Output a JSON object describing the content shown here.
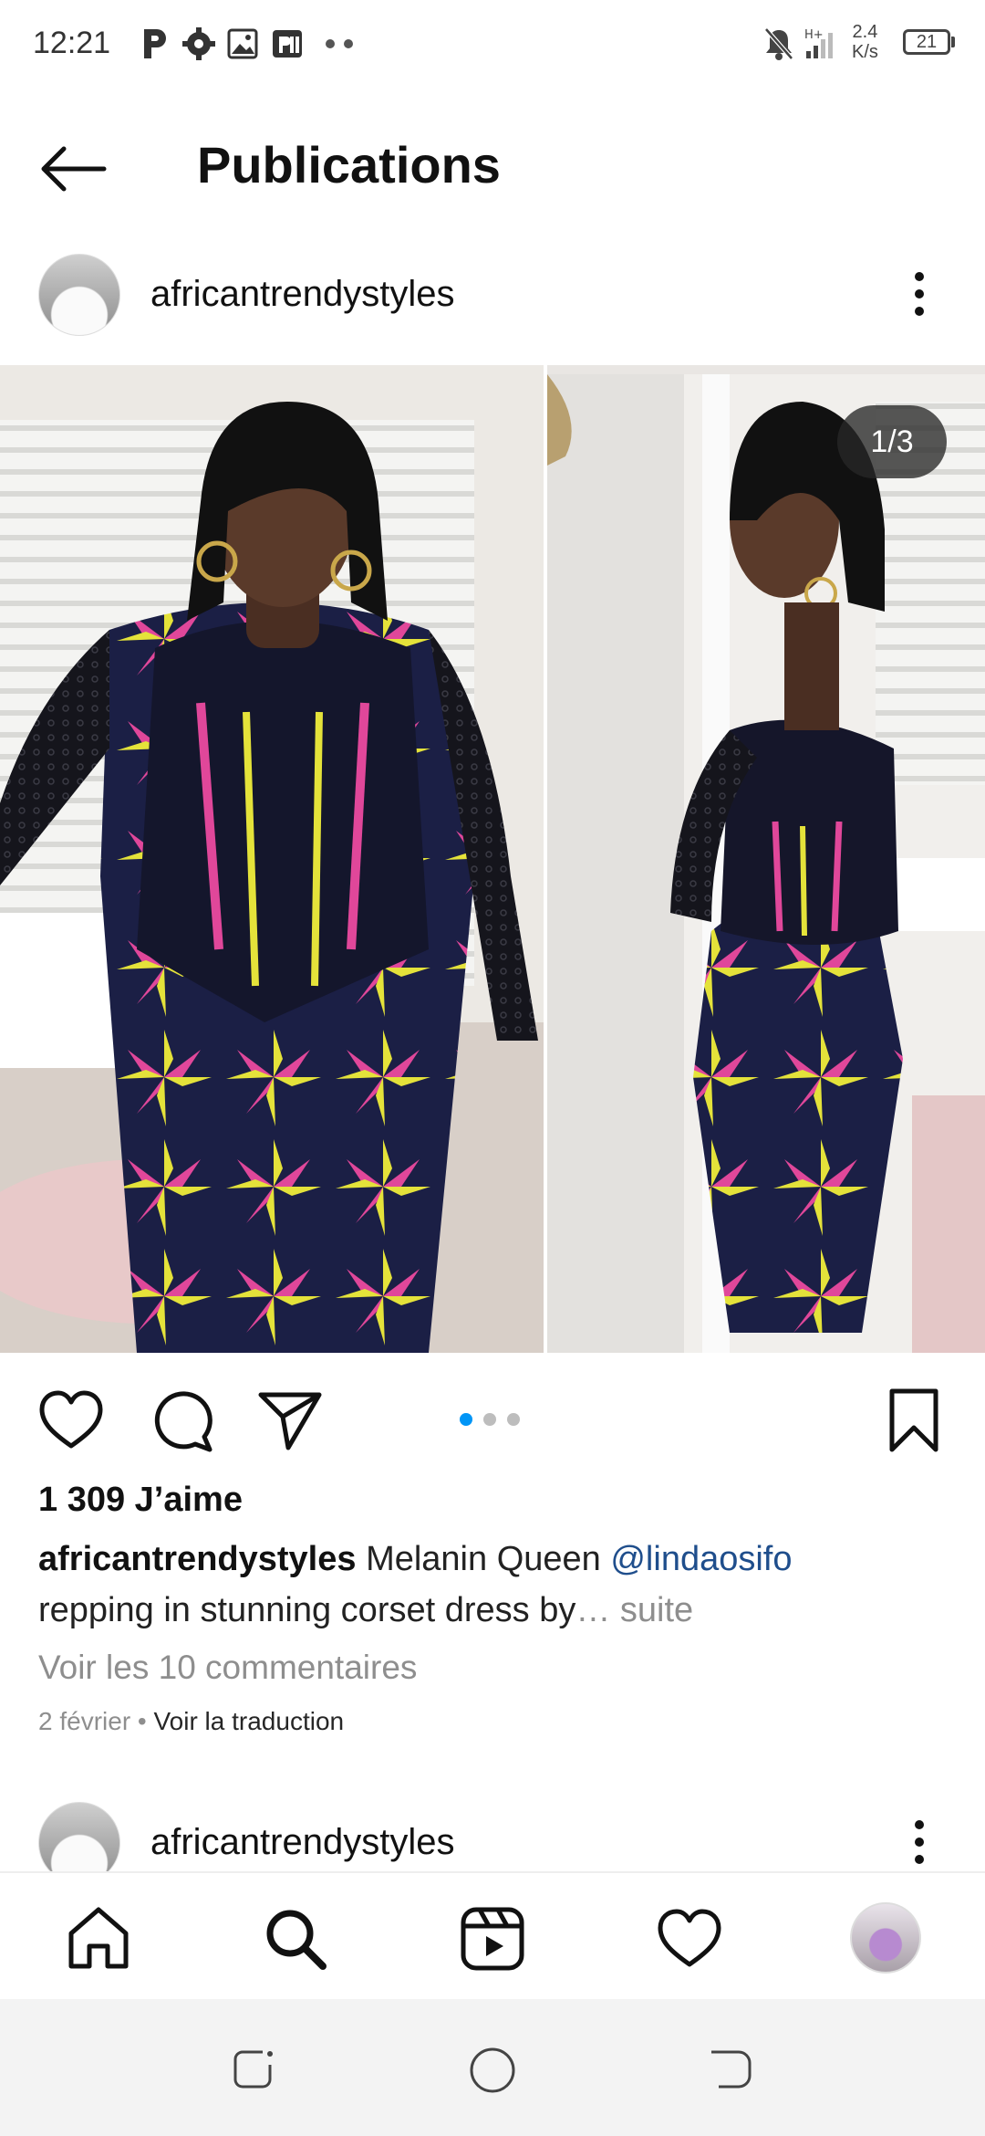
{
  "status_bar": {
    "time": "12:21",
    "speed_value": "2.4",
    "speed_unit": "K/s",
    "battery": "21"
  },
  "header": {
    "title": "Publications"
  },
  "post": {
    "username": "africantrendystyles",
    "image_counter": "1/3",
    "likes": "1 309 J’aime",
    "caption_user": "africantrendystyles",
    "caption_text_1": "Melanin  Queen ",
    "caption_mention": "@lindaosifo",
    "caption_text_2": "repping in stunning corset dress by",
    "caption_more": "… suite",
    "comments_link": "Voir les 10 commentaires",
    "date": "2 février",
    "separator": " • ",
    "translate": "Voir la traduction",
    "carousel": {
      "count": 3,
      "active": 0
    }
  },
  "next_post": {
    "username": "africantrendystyles"
  },
  "colors": {
    "accent": "#0095f6",
    "mention": "#1f4e8c",
    "muted": "#8e8e8e",
    "dress_pink": "#e0479a",
    "dress_yellow": "#e4e23a",
    "dress_navy": "#1b1f45"
  },
  "icons": {
    "status": [
      "parking-icon",
      "gear-icon",
      "image-icon",
      "app-icon",
      "more-dots-icon",
      "mute-icon",
      "signal-icon"
    ],
    "actions": [
      "heart-icon",
      "comment-icon",
      "share-icon",
      "bookmark-icon"
    ],
    "nav": [
      "home-icon",
      "search-icon",
      "reels-icon",
      "activity-heart-icon",
      "profile-avatar"
    ]
  }
}
